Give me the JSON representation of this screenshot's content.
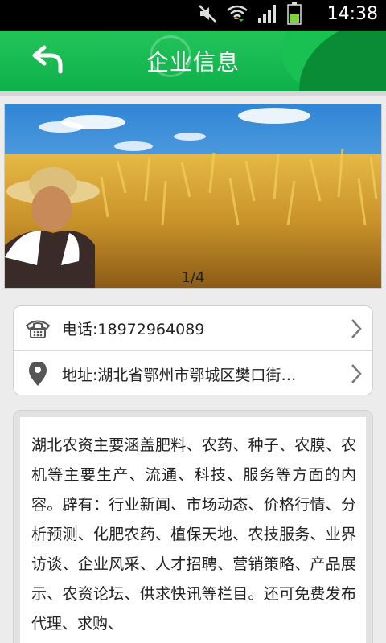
{
  "status_bar": {
    "time": "14:38",
    "icons": [
      "mute-icon",
      "wifi-icon",
      "signal-icon",
      "battery-icon"
    ]
  },
  "header": {
    "title": "企业信息",
    "back_icon": "back-arrow-icon",
    "color": "#14b54e"
  },
  "banner": {
    "page_indicator": "1/4"
  },
  "contact": {
    "phone": "电话:18972964089",
    "address": "地址:湖北省鄂州市鄂城区樊口街…"
  },
  "description": {
    "text": "湖北农资主要涵盖肥料、农药、种子、农膜、农机等主要生产、流通、科技、服务等方面的内容。辟有：行业新闻、市场动态、价格行情、分析预测、化肥农药、植保天地、农技服务、业界访谈、企业风采、人才招聘、营销策略、产品展示、农资论坛、供求快讯等栏目。还可免费发布代理、求购、"
  }
}
